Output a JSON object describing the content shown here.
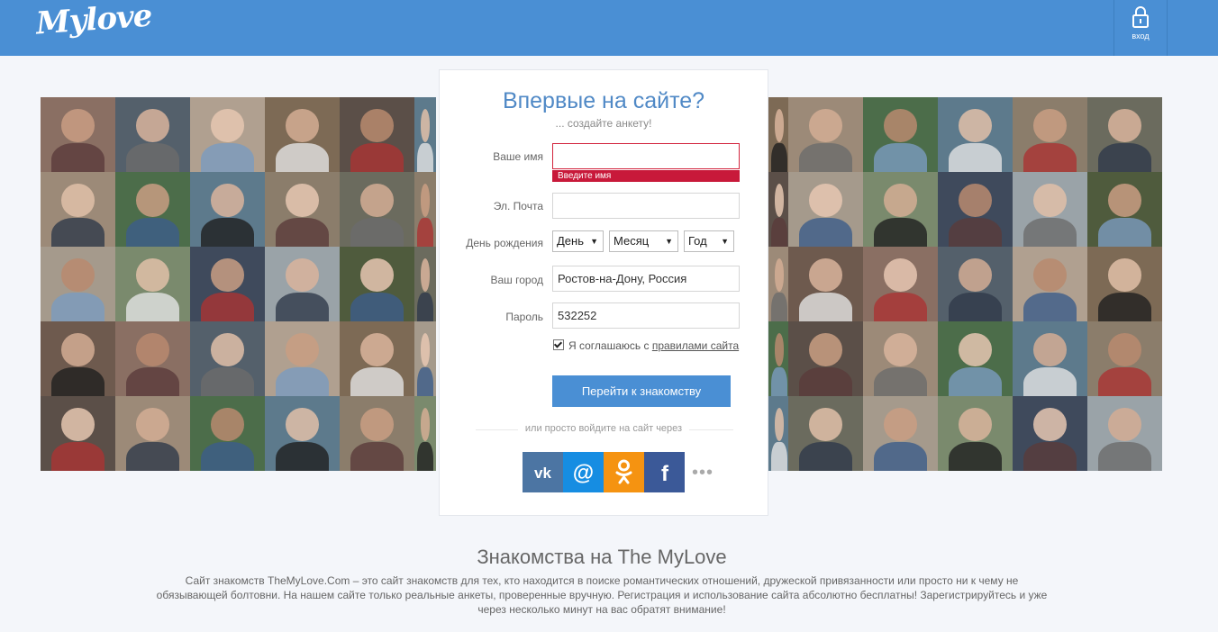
{
  "header": {
    "logo_text": "Mylove",
    "login_label": "вход",
    "login_icon": "lock-icon"
  },
  "card": {
    "title": "Впервые на сайте?",
    "subtitle": "... создайте анкету!",
    "name": {
      "label": "Ваше имя",
      "value": "",
      "error": "Введите имя"
    },
    "email": {
      "label": "Эл. Почта",
      "value": ""
    },
    "birthday": {
      "label": "День рождения",
      "day": "День",
      "month": "Месяц",
      "year": "Год"
    },
    "city": {
      "label": "Ваш город",
      "value": "Ростов-на-Дону, Россия"
    },
    "password": {
      "label": "Пароль",
      "value": "532252"
    },
    "agree": {
      "prefix": "Я соглашаюсь с",
      "link": "правилами сайта",
      "checked": true
    },
    "submit_label": "Перейти к знакомству",
    "or_text": "или просто войдите на сайт через",
    "social": [
      {
        "name": "vk-icon",
        "color": "#4c75a3"
      },
      {
        "name": "mail-icon",
        "color": "#168de2"
      },
      {
        "name": "odnoklassniki-icon",
        "color": "#f59311"
      },
      {
        "name": "facebook-icon",
        "color": "#3b5998"
      }
    ],
    "more_label": "•••"
  },
  "footer": {
    "title": "Знакомства на The MyLove",
    "text": "Сайт знакомств TheMyLove.Com – это сайт знакомств для тех, кто находится в поиске романтических отношений, дружеской привязанности или просто ни к чему не обязывающей болтовни. На нашем сайте только реальные анкеты, проверенные вручную. Регистрация и использование сайта абсолютно бесплатны! Зарегистрируйтесь и уже через несколько минут на вас обратят внимание!"
  },
  "colors": {
    "accent": "#4a8fd4",
    "error": "#c8193a",
    "title": "#5089c6"
  }
}
